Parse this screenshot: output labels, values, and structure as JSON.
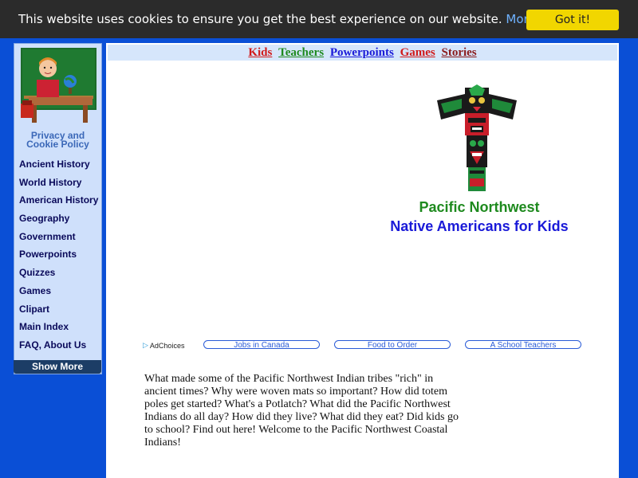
{
  "cookie_bar": {
    "text": "This website uses cookies to ensure you get the best experience on our website.",
    "link": "More info.",
    "button": "Got it!"
  },
  "sidebar": {
    "privacy_line1": "Privacy and",
    "privacy_line2": "Cookie Policy",
    "items": [
      {
        "label": "Ancient History"
      },
      {
        "label": "World History"
      },
      {
        "label": "American History"
      },
      {
        "label": "Geography"
      },
      {
        "label": "Government"
      },
      {
        "label": "Powerpoints"
      },
      {
        "label": "Quizzes"
      },
      {
        "label": "Games"
      },
      {
        "label": "Clipart"
      },
      {
        "label": "Main Index"
      },
      {
        "label": "FAQ, About Us"
      }
    ],
    "show_more": "Show More"
  },
  "topnav": {
    "kids": "Kids",
    "teachers": "Teachers",
    "powerpoints": "Powerpoints",
    "games": "Games",
    "stories": "Stories"
  },
  "page": {
    "title_line1": "Pacific Northwest",
    "title_line2": "Native Americans for Kids",
    "intro": "What made some of the Pacific Northwest Indian tribes \"rich\" in ancient times? Why were woven mats so important? How did totem poles get started? What's a Potlatch? What did the Pacific Northwest Indians do all day? How did they live? What did they eat? Did kids go to school? Find out here! Welcome to the Pacific Northwest Coastal Indians!"
  },
  "ads": {
    "adchoices": "AdChoices",
    "links": [
      "Jobs in Canada",
      "Food to Order",
      "A School Teachers"
    ]
  },
  "colors": {
    "page_bg": "#0a4fd6",
    "cookie_bg": "#2b2b2b",
    "got_it_bg": "#f1d600",
    "sidebar_bg": "#cfe0fb",
    "topnav_bg": "#d6e6fb",
    "title_green": "#1e8a1e",
    "title_blue": "#1a1ad8"
  },
  "icons": {
    "teacher": "teacher-clipart-icon",
    "totem": "totem-pole-icon",
    "adchoices": "adchoices-icon"
  }
}
